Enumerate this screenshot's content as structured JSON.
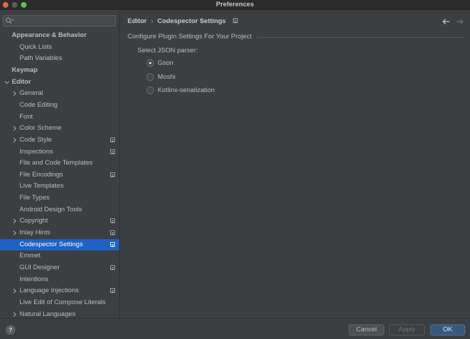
{
  "window": {
    "title": "Preferences"
  },
  "sidebar": {
    "search_placeholder": "",
    "items": [
      {
        "label": "Appearance & Behavior",
        "level": 0,
        "bold": true,
        "arrow": "none"
      },
      {
        "label": "Quick Lists",
        "level": 1,
        "arrow": "none"
      },
      {
        "label": "Path Variables",
        "level": 1,
        "arrow": "none"
      },
      {
        "label": "Keymap",
        "level": 0,
        "bold": true,
        "arrow": "none"
      },
      {
        "label": "Editor",
        "level": 0,
        "bold": true,
        "arrow": "expanded"
      },
      {
        "label": "General",
        "level": 1,
        "arrow": "collapsed"
      },
      {
        "label": "Code Editing",
        "level": 1,
        "arrow": "none"
      },
      {
        "label": "Font",
        "level": 1,
        "arrow": "none"
      },
      {
        "label": "Color Scheme",
        "level": 1,
        "arrow": "collapsed"
      },
      {
        "label": "Code Style",
        "level": 1,
        "arrow": "collapsed",
        "project": true
      },
      {
        "label": "Inspections",
        "level": 1,
        "arrow": "none",
        "project": true
      },
      {
        "label": "File and Code Templates",
        "level": 1,
        "arrow": "none"
      },
      {
        "label": "File Encodings",
        "level": 1,
        "arrow": "none",
        "project": true
      },
      {
        "label": "Live Templates",
        "level": 1,
        "arrow": "none"
      },
      {
        "label": "File Types",
        "level": 1,
        "arrow": "none"
      },
      {
        "label": "Android Design Tools",
        "level": 1,
        "arrow": "none"
      },
      {
        "label": "Copyright",
        "level": 1,
        "arrow": "collapsed",
        "project": true
      },
      {
        "label": "Inlay Hints",
        "level": 1,
        "arrow": "collapsed",
        "project": true
      },
      {
        "label": "Codespector Settings",
        "level": 1,
        "arrow": "none",
        "project": true,
        "selected": true
      },
      {
        "label": "Emmet",
        "level": 1,
        "arrow": "none"
      },
      {
        "label": "GUI Designer",
        "level": 1,
        "arrow": "none",
        "project": true
      },
      {
        "label": "Intentions",
        "level": 1,
        "arrow": "none"
      },
      {
        "label": "Language Injections",
        "level": 1,
        "arrow": "collapsed",
        "project": true
      },
      {
        "label": "Live Edit of Compose Literals",
        "level": 1,
        "arrow": "none"
      },
      {
        "label": "Natural Languages",
        "level": 1,
        "arrow": "collapsed"
      }
    ]
  },
  "breadcrumb": {
    "parent": "Editor",
    "separator": "›",
    "current": "Codespector Settings"
  },
  "content": {
    "group_title": "Configure Plugin Settings For Your Project",
    "parser_label": "Select JSON parser:",
    "options": [
      {
        "label": "Gson",
        "checked": true
      },
      {
        "label": "Moshi",
        "checked": false
      },
      {
        "label": "Kotlinx-serialization",
        "checked": false
      }
    ]
  },
  "footer": {
    "help": "?",
    "cancel": "Cancel",
    "apply": "Apply",
    "ok": "OK"
  },
  "colors": {
    "background": "#3c3f41",
    "selection": "#1d63c6",
    "ok_button": "#365880",
    "text": "#bbbbbb"
  }
}
